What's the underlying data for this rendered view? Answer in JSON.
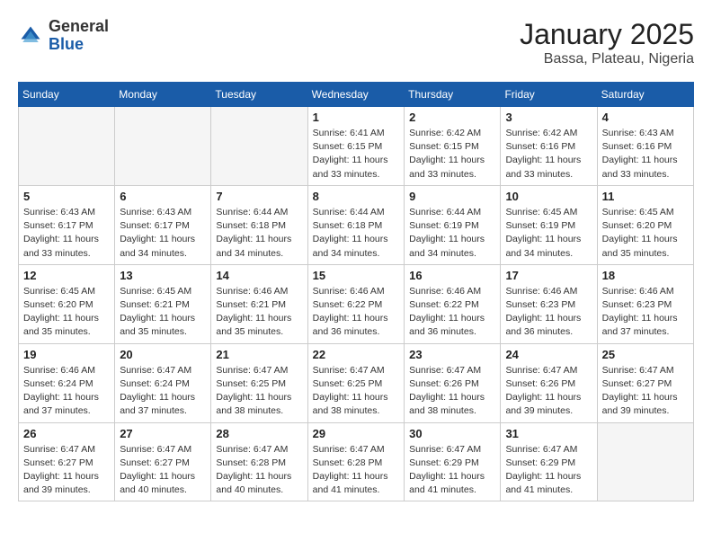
{
  "logo": {
    "general": "General",
    "blue": "Blue"
  },
  "header": {
    "month": "January 2025",
    "location": "Bassa, Plateau, Nigeria"
  },
  "weekdays": [
    "Sunday",
    "Monday",
    "Tuesday",
    "Wednesday",
    "Thursday",
    "Friday",
    "Saturday"
  ],
  "weeks": [
    [
      {
        "day": "",
        "info": ""
      },
      {
        "day": "",
        "info": ""
      },
      {
        "day": "",
        "info": ""
      },
      {
        "day": "1",
        "info": "Sunrise: 6:41 AM\nSunset: 6:15 PM\nDaylight: 11 hours\nand 33 minutes."
      },
      {
        "day": "2",
        "info": "Sunrise: 6:42 AM\nSunset: 6:15 PM\nDaylight: 11 hours\nand 33 minutes."
      },
      {
        "day": "3",
        "info": "Sunrise: 6:42 AM\nSunset: 6:16 PM\nDaylight: 11 hours\nand 33 minutes."
      },
      {
        "day": "4",
        "info": "Sunrise: 6:43 AM\nSunset: 6:16 PM\nDaylight: 11 hours\nand 33 minutes."
      }
    ],
    [
      {
        "day": "5",
        "info": "Sunrise: 6:43 AM\nSunset: 6:17 PM\nDaylight: 11 hours\nand 33 minutes."
      },
      {
        "day": "6",
        "info": "Sunrise: 6:43 AM\nSunset: 6:17 PM\nDaylight: 11 hours\nand 34 minutes."
      },
      {
        "day": "7",
        "info": "Sunrise: 6:44 AM\nSunset: 6:18 PM\nDaylight: 11 hours\nand 34 minutes."
      },
      {
        "day": "8",
        "info": "Sunrise: 6:44 AM\nSunset: 6:18 PM\nDaylight: 11 hours\nand 34 minutes."
      },
      {
        "day": "9",
        "info": "Sunrise: 6:44 AM\nSunset: 6:19 PM\nDaylight: 11 hours\nand 34 minutes."
      },
      {
        "day": "10",
        "info": "Sunrise: 6:45 AM\nSunset: 6:19 PM\nDaylight: 11 hours\nand 34 minutes."
      },
      {
        "day": "11",
        "info": "Sunrise: 6:45 AM\nSunset: 6:20 PM\nDaylight: 11 hours\nand 35 minutes."
      }
    ],
    [
      {
        "day": "12",
        "info": "Sunrise: 6:45 AM\nSunset: 6:20 PM\nDaylight: 11 hours\nand 35 minutes."
      },
      {
        "day": "13",
        "info": "Sunrise: 6:45 AM\nSunset: 6:21 PM\nDaylight: 11 hours\nand 35 minutes."
      },
      {
        "day": "14",
        "info": "Sunrise: 6:46 AM\nSunset: 6:21 PM\nDaylight: 11 hours\nand 35 minutes."
      },
      {
        "day": "15",
        "info": "Sunrise: 6:46 AM\nSunset: 6:22 PM\nDaylight: 11 hours\nand 36 minutes."
      },
      {
        "day": "16",
        "info": "Sunrise: 6:46 AM\nSunset: 6:22 PM\nDaylight: 11 hours\nand 36 minutes."
      },
      {
        "day": "17",
        "info": "Sunrise: 6:46 AM\nSunset: 6:23 PM\nDaylight: 11 hours\nand 36 minutes."
      },
      {
        "day": "18",
        "info": "Sunrise: 6:46 AM\nSunset: 6:23 PM\nDaylight: 11 hours\nand 37 minutes."
      }
    ],
    [
      {
        "day": "19",
        "info": "Sunrise: 6:46 AM\nSunset: 6:24 PM\nDaylight: 11 hours\nand 37 minutes."
      },
      {
        "day": "20",
        "info": "Sunrise: 6:47 AM\nSunset: 6:24 PM\nDaylight: 11 hours\nand 37 minutes."
      },
      {
        "day": "21",
        "info": "Sunrise: 6:47 AM\nSunset: 6:25 PM\nDaylight: 11 hours\nand 38 minutes."
      },
      {
        "day": "22",
        "info": "Sunrise: 6:47 AM\nSunset: 6:25 PM\nDaylight: 11 hours\nand 38 minutes."
      },
      {
        "day": "23",
        "info": "Sunrise: 6:47 AM\nSunset: 6:26 PM\nDaylight: 11 hours\nand 38 minutes."
      },
      {
        "day": "24",
        "info": "Sunrise: 6:47 AM\nSunset: 6:26 PM\nDaylight: 11 hours\nand 39 minutes."
      },
      {
        "day": "25",
        "info": "Sunrise: 6:47 AM\nSunset: 6:27 PM\nDaylight: 11 hours\nand 39 minutes."
      }
    ],
    [
      {
        "day": "26",
        "info": "Sunrise: 6:47 AM\nSunset: 6:27 PM\nDaylight: 11 hours\nand 39 minutes."
      },
      {
        "day": "27",
        "info": "Sunrise: 6:47 AM\nSunset: 6:27 PM\nDaylight: 11 hours\nand 40 minutes."
      },
      {
        "day": "28",
        "info": "Sunrise: 6:47 AM\nSunset: 6:28 PM\nDaylight: 11 hours\nand 40 minutes."
      },
      {
        "day": "29",
        "info": "Sunrise: 6:47 AM\nSunset: 6:28 PM\nDaylight: 11 hours\nand 41 minutes."
      },
      {
        "day": "30",
        "info": "Sunrise: 6:47 AM\nSunset: 6:29 PM\nDaylight: 11 hours\nand 41 minutes."
      },
      {
        "day": "31",
        "info": "Sunrise: 6:47 AM\nSunset: 6:29 PM\nDaylight: 11 hours\nand 41 minutes."
      },
      {
        "day": "",
        "info": ""
      }
    ]
  ]
}
